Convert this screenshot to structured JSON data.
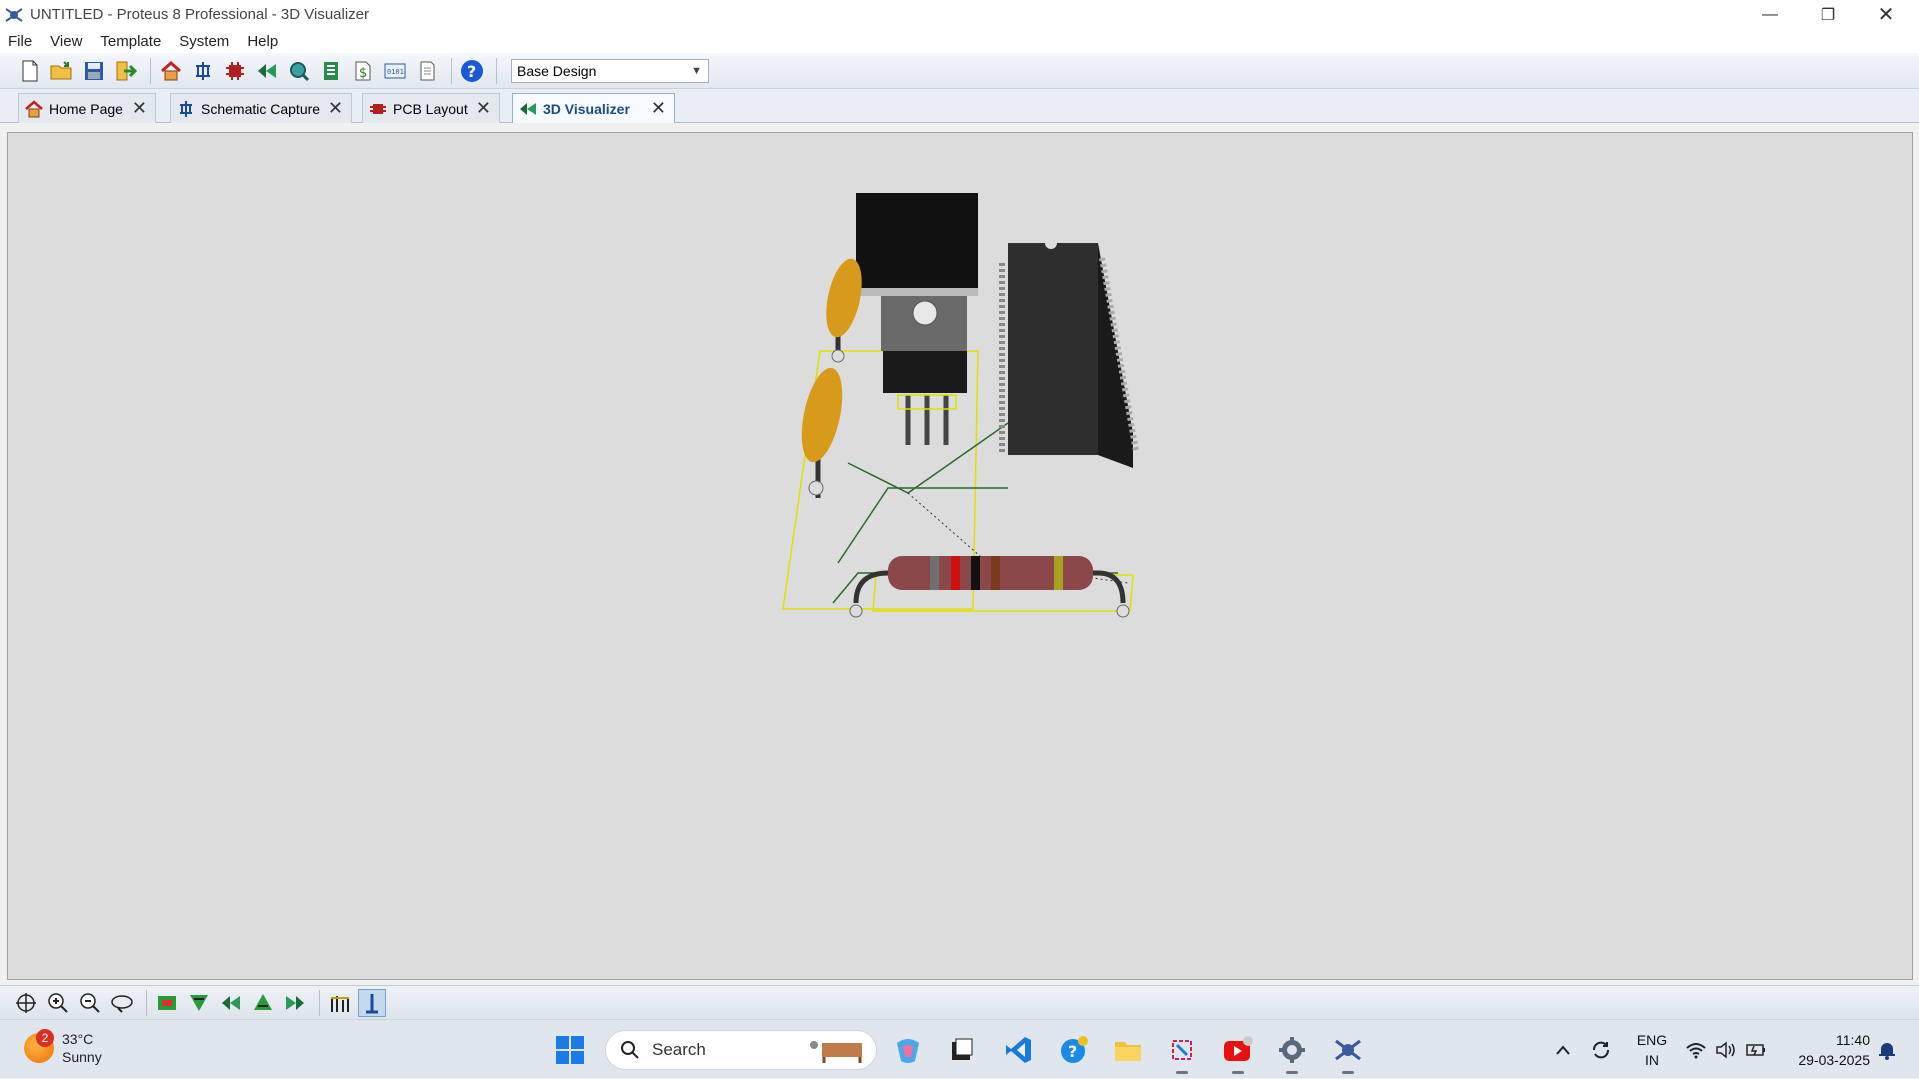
{
  "window": {
    "title": "UNTITLED - Proteus 8 Professional - 3D Visualizer"
  },
  "menu": [
    "File",
    "View",
    "Template",
    "System",
    "Help"
  ],
  "toolbar": {
    "variant_selected": "Base Design"
  },
  "tabs": [
    {
      "label": "Home Page",
      "icon": "home-icon",
      "active": false
    },
    {
      "label": "Schematic Capture",
      "icon": "schematic-icon",
      "active": false
    },
    {
      "label": "PCB Layout",
      "icon": "pcb-icon",
      "active": false
    },
    {
      "label": "3D Visualizer",
      "icon": "3d-visualizer-icon",
      "active": true
    }
  ],
  "taskbar": {
    "weather": {
      "temp": "33°C",
      "condition": "Sunny",
      "badge": "2"
    },
    "search_placeholder": "Search",
    "language": {
      "line1": "ENG",
      "line2": "IN"
    },
    "time": "11:40",
    "date": "29-03-2025"
  },
  "colors": {
    "viewport_bg": "#dcdcdc",
    "board_outline": "#e0e000",
    "capacitor": "#d89a1a",
    "resistor_body": "#8a4848",
    "ic_body": "#2e2e2e"
  }
}
